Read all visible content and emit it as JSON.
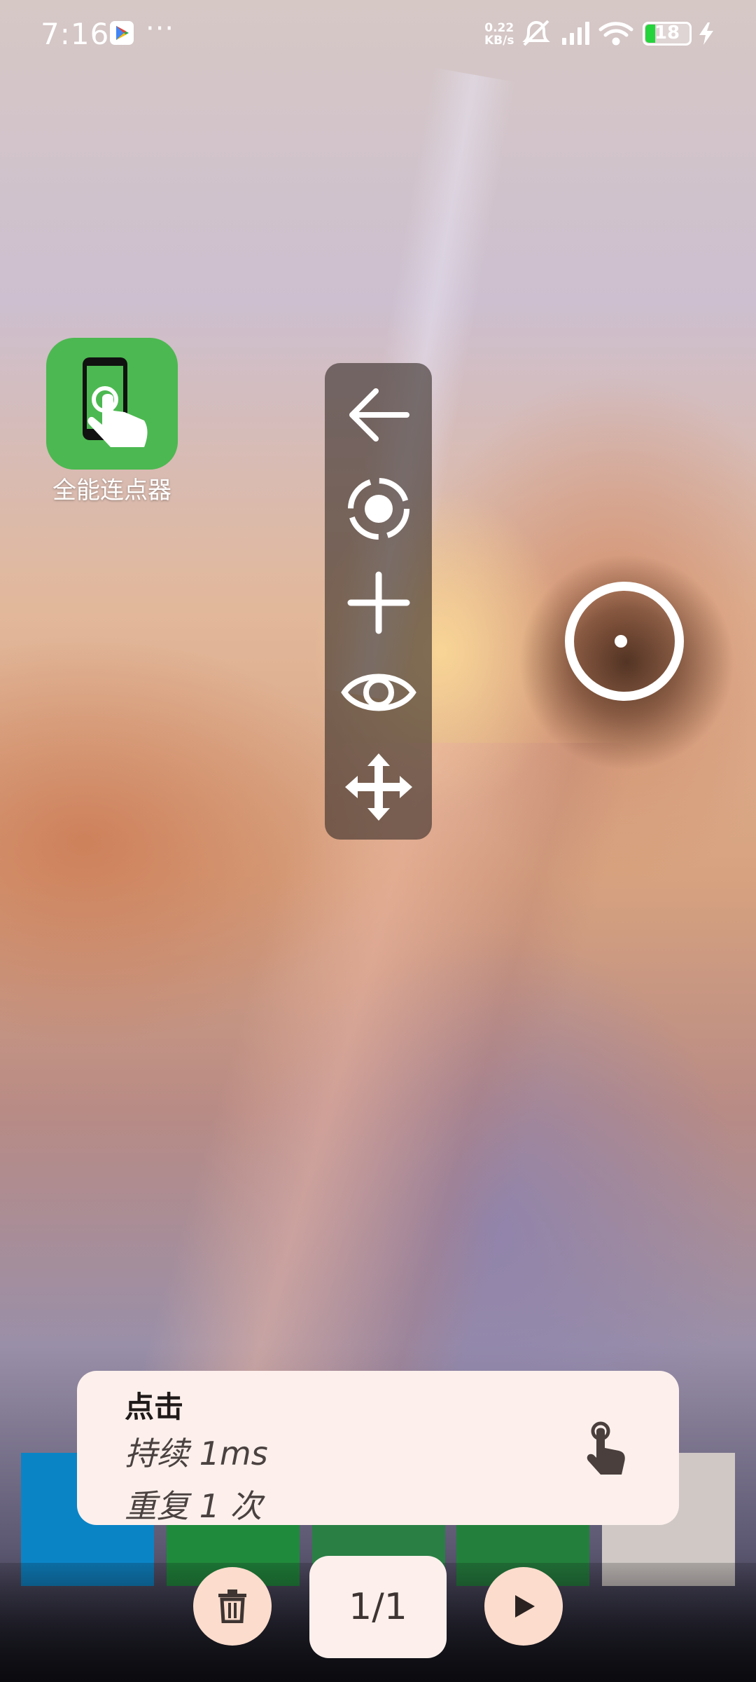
{
  "status_bar": {
    "time": "7:16",
    "more": "···",
    "net_speed_value": "0.22",
    "net_speed_unit": "KB/s",
    "battery": "18",
    "icons": [
      "google-play-icon",
      "silent-icon",
      "signal-icon",
      "wifi-icon",
      "battery-icon",
      "charging-icon"
    ]
  },
  "home": {
    "app_label": "全能连点器"
  },
  "toolbar": {
    "buttons": [
      "back-arrow-icon",
      "record-icon",
      "add-icon",
      "eye-icon",
      "move-icon"
    ]
  },
  "action_card": {
    "title": "点击",
    "duration": "持续 1ms",
    "repeat": "重复 1 次",
    "icon": "tap-hand-icon"
  },
  "controls": {
    "counter": "1/1",
    "delete_icon": "trash-icon",
    "play_icon": "play-icon"
  },
  "colors": {
    "app_icon_bg": "#4cb851",
    "card_bg": "#fdf0ec",
    "button_bg": "#fcdccc",
    "battery_green": "#25d33d"
  }
}
